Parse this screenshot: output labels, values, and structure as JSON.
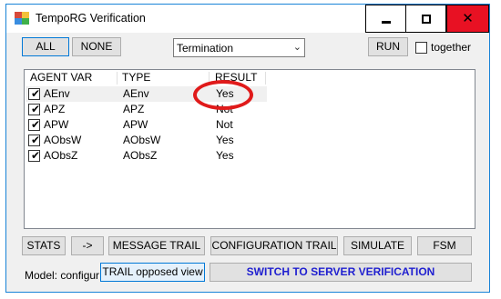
{
  "window": {
    "title": "TempoRG Verification",
    "controls": {
      "minimize": "▁",
      "maximize": "□",
      "close": "✕"
    }
  },
  "toolbar": {
    "all_label": "ALL",
    "none_label": "NONE",
    "mode_select": {
      "value": "Termination"
    },
    "run_label": "RUN",
    "together_label": "together",
    "together_checked": false
  },
  "table": {
    "columns": [
      "AGENT VAR",
      "TYPE",
      "RESULT"
    ],
    "rows": [
      {
        "checked": true,
        "agent_var": "AEnv",
        "type": "AEnv",
        "result": "Yes"
      },
      {
        "checked": true,
        "agent_var": "APZ",
        "type": "APZ",
        "result": "Not"
      },
      {
        "checked": true,
        "agent_var": "APW",
        "type": "APW",
        "result": "Not"
      },
      {
        "checked": true,
        "agent_var": "AObsW",
        "type": "AObsW",
        "result": "Yes"
      },
      {
        "checked": true,
        "agent_var": "AObsZ",
        "type": "AObsZ",
        "result": "Yes"
      }
    ],
    "check_glyph": "✔"
  },
  "actions": {
    "stats_label": "STATS",
    "arrow_label": "->",
    "message_trail_label": "MESSAGE TRAIL",
    "configuration_trail_label": "CONFIGURATION TRAIL",
    "simulate_label": "SIMULATE",
    "fsm_label": "FSM"
  },
  "footer": {
    "model_label": "Model: configurati",
    "trail_opposed_label": "TRAIL opposed view",
    "switch_label": "SWITCH TO SERVER VERIFICATION"
  },
  "colors": {
    "accent": "#0078d7",
    "close_button": "#e81123",
    "highlight": "#e01a1a",
    "switch_text": "#2020d0"
  }
}
